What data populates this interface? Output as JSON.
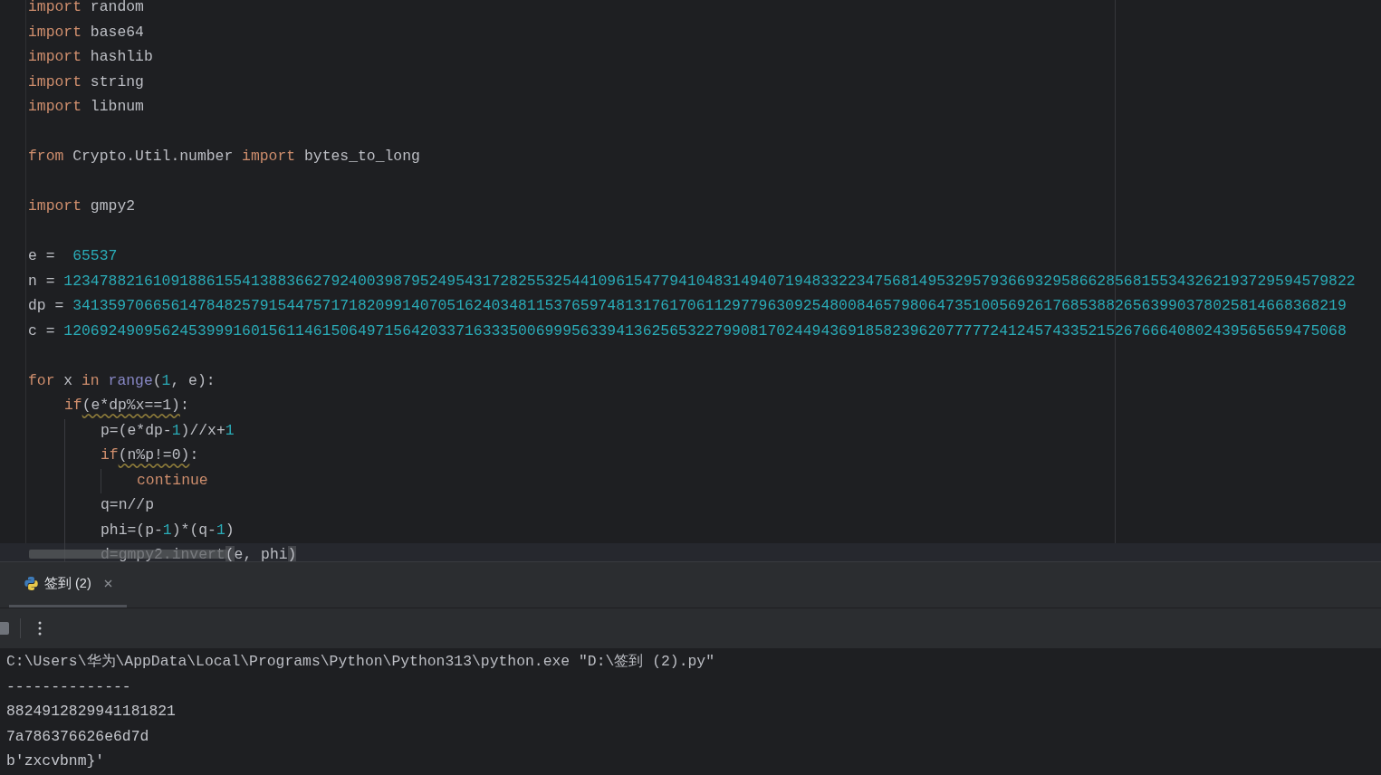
{
  "editor": {
    "lines": [
      {
        "kind": "code",
        "current": false,
        "tokens": [
          {
            "kind": "keyword",
            "text": "import"
          },
          {
            "kind": "plain",
            "text": " random"
          }
        ]
      },
      {
        "kind": "code",
        "current": false,
        "tokens": [
          {
            "kind": "keyword",
            "text": "import"
          },
          {
            "kind": "plain",
            "text": " base64"
          }
        ]
      },
      {
        "kind": "code",
        "current": false,
        "tokens": [
          {
            "kind": "keyword",
            "text": "import"
          },
          {
            "kind": "plain",
            "text": " hashlib"
          }
        ]
      },
      {
        "kind": "code",
        "current": false,
        "tokens": [
          {
            "kind": "keyword",
            "text": "import"
          },
          {
            "kind": "plain",
            "text": " string"
          }
        ]
      },
      {
        "kind": "code",
        "current": false,
        "tokens": [
          {
            "kind": "keyword",
            "text": "import"
          },
          {
            "kind": "plain",
            "text": " libnum"
          }
        ]
      },
      {
        "kind": "blank",
        "current": false
      },
      {
        "kind": "code",
        "current": false,
        "tokens": [
          {
            "kind": "keyword",
            "text": "from"
          },
          {
            "kind": "plain",
            "text": " Crypto.Util.number "
          },
          {
            "kind": "keyword",
            "text": "import"
          },
          {
            "kind": "plain",
            "text": " bytes_to_long"
          }
        ]
      },
      {
        "kind": "blank",
        "current": false
      },
      {
        "kind": "code",
        "current": false,
        "tokens": [
          {
            "kind": "keyword",
            "text": "import"
          },
          {
            "kind": "plain",
            "text": " gmpy2"
          }
        ]
      },
      {
        "kind": "blank",
        "current": false
      },
      {
        "kind": "code",
        "current": false,
        "tokens": [
          {
            "kind": "plain",
            "text": "e =  "
          },
          {
            "kind": "number",
            "text": "65537"
          }
        ]
      },
      {
        "kind": "code",
        "current": false,
        "tokens": [
          {
            "kind": "plain",
            "text": "n = "
          },
          {
            "kind": "number",
            "text": "1234788216109188615541388366279240039879524954317282553254410961547794104831494071948332234756814953295793669329586628568155343262193729594579822"
          }
        ]
      },
      {
        "kind": "code",
        "current": false,
        "tokens": [
          {
            "kind": "plain",
            "text": "dp = "
          },
          {
            "kind": "number",
            "text": "34135970665614784825791544757171820991407051624034811537659748131761706112977963092548008465798064735100569261768538826563990378025814668368219"
          }
        ]
      },
      {
        "kind": "code",
        "current": false,
        "tokens": [
          {
            "kind": "plain",
            "text": "c = "
          },
          {
            "kind": "number",
            "text": "120692490956245399916015611461506497156420337163335006999563394136256532279908170244943691858239620777772412457433521526766640802439565659475068"
          }
        ]
      },
      {
        "kind": "blank",
        "current": false
      },
      {
        "kind": "code",
        "current": false,
        "tokens": [
          {
            "kind": "keyword",
            "text": "for"
          },
          {
            "kind": "plain",
            "text": " x "
          },
          {
            "kind": "keyword",
            "text": "in"
          },
          {
            "kind": "builtin",
            "text": " range"
          },
          {
            "kind": "plain",
            "text": "("
          },
          {
            "kind": "number",
            "text": "1"
          },
          {
            "kind": "plain",
            "text": ", e):"
          }
        ]
      },
      {
        "kind": "code",
        "current": false,
        "tokens": [
          {
            "kind": "keyword",
            "text": "    if"
          },
          {
            "kind": "warning",
            "text": "(e*dp%x==1)"
          },
          {
            "kind": "plain",
            "text": ":"
          }
        ]
      },
      {
        "kind": "code",
        "current": false,
        "tokens": [
          {
            "kind": "plain",
            "text": "        p=(e*dp-"
          },
          {
            "kind": "number",
            "text": "1"
          },
          {
            "kind": "plain",
            "text": ")//x+"
          },
          {
            "kind": "number",
            "text": "1"
          }
        ]
      },
      {
        "kind": "code",
        "current": false,
        "tokens": [
          {
            "kind": "keyword",
            "text": "        if"
          },
          {
            "kind": "warning",
            "text": "(n%p!=0)"
          },
          {
            "kind": "plain",
            "text": ":"
          }
        ]
      },
      {
        "kind": "code",
        "current": false,
        "tokens": [
          {
            "kind": "keyword",
            "text": "            continue"
          }
        ]
      },
      {
        "kind": "code",
        "current": false,
        "tokens": [
          {
            "kind": "plain",
            "text": "        q=n//p"
          }
        ]
      },
      {
        "kind": "code",
        "current": false,
        "tokens": [
          {
            "kind": "plain",
            "text": "        phi=(p-"
          },
          {
            "kind": "number",
            "text": "1"
          },
          {
            "kind": "plain",
            "text": ")*(q-"
          },
          {
            "kind": "number",
            "text": "1"
          },
          {
            "kind": "plain",
            "text": ")"
          }
        ]
      },
      {
        "kind": "code",
        "current": true,
        "tokens": [
          {
            "kind": "plain",
            "text": "        d=gmpy2.invert"
          },
          {
            "kind": "brace",
            "text": "("
          },
          {
            "kind": "plain",
            "text": "e, phi"
          },
          {
            "kind": "brace",
            "text": ")"
          }
        ]
      }
    ]
  },
  "run_panel": {
    "tabs": [
      {
        "label": "签到 (2)",
        "selected": true
      }
    ],
    "console": [
      {
        "kind": "command",
        "text": "C:\\Users\\华为\\AppData\\Local\\Programs\\Python\\Python313\\python.exe \"D:\\签到 (2).py\""
      },
      {
        "kind": "output",
        "text": "--------------"
      },
      {
        "kind": "output",
        "text": "8824912829941181821"
      },
      {
        "kind": "output",
        "text": "7a786376626e6d7d"
      },
      {
        "kind": "output",
        "text": "b'zxcvbnm}'"
      }
    ]
  }
}
